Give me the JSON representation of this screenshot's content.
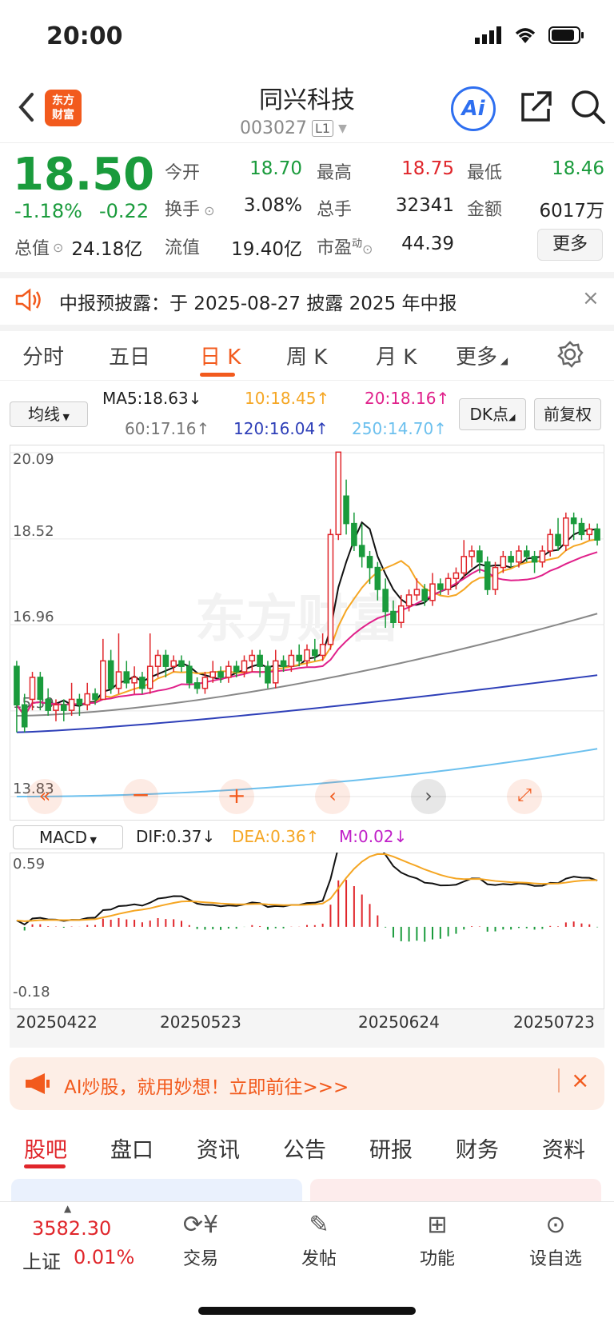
{
  "status": {
    "time": "20:00"
  },
  "header": {
    "logo_line1": "东方",
    "logo_line2": "财富",
    "name": "同兴科技",
    "code": "003027",
    "level": "L1",
    "ai_label": "Ai"
  },
  "quote": {
    "price": "18.50",
    "change_pct": "-1.18%",
    "change": "-0.22",
    "open_label": "今开",
    "open": "18.70",
    "high_label": "最高",
    "high": "18.75",
    "low_label": "最低",
    "low": "18.46",
    "turnover_label": "换手",
    "turnover": "3.08%",
    "volume_label": "总手",
    "volume": "32341",
    "amount_label": "金额",
    "amount": "6017万",
    "mktcap_label": "总值",
    "mktcap": "24.18亿",
    "float_label": "流值",
    "float": "19.40亿",
    "pe_label": "市盈",
    "pe_sup": "动",
    "pe": "44.39",
    "more_label": "更多"
  },
  "notice": {
    "text": "中报预披露：于 2025-08-27 披露 2025 年中报"
  },
  "chart_tabs": [
    "分时",
    "五日",
    "日 K",
    "周 K",
    "月 K",
    "更多"
  ],
  "active_tab": "日 K",
  "ma_bar": {
    "selector": "均线",
    "ma5": "MA5:18.63",
    "ma10": "10:18.45",
    "ma20": "20:18.16",
    "ma60": "60:17.16",
    "ma120": "120:16.04",
    "ma250": "250:14.70",
    "dk_label": "DK点",
    "fq_label": "前复权"
  },
  "price_axis": [
    "20.09",
    "18.52",
    "16.96",
    "15.39",
    "13.83"
  ],
  "macd_bar": {
    "selector": "MACD",
    "dif": "DIF:0.37",
    "dea": "DEA:0.36",
    "m": "M:0.02"
  },
  "macd_axis": [
    "0.59",
    "-0.18"
  ],
  "dates": [
    "20250422",
    "20250523",
    "20250624",
    "20250723"
  ],
  "watermark": "东方财富",
  "colors": {
    "up": "#e0262b",
    "down": "#1a9b3c",
    "ma5": "#111111",
    "ma10": "#f5a623",
    "ma20": "#e0208a",
    "ma60": "#888888",
    "ma120": "#2e3fb8",
    "ma250": "#6cc0ee",
    "accent": "#f25a1d"
  },
  "chart_data": {
    "type": "candlestick",
    "y_range": [
      13.83,
      20.09
    ],
    "candles": [
      [
        16.2,
        15.5,
        16.3,
        15.0
      ],
      [
        15.5,
        15.1,
        15.7,
        15.0
      ],
      [
        15.6,
        16.0,
        16.1,
        15.4
      ],
      [
        16.0,
        15.6,
        16.1,
        15.4
      ],
      [
        15.6,
        15.4,
        15.8,
        15.3
      ],
      [
        15.4,
        15.5,
        15.6,
        15.2
      ],
      [
        15.5,
        15.4,
        15.6,
        15.2
      ],
      [
        15.4,
        15.6,
        15.9,
        15.3
      ],
      [
        15.6,
        15.5,
        15.7,
        15.3
      ],
      [
        15.5,
        15.7,
        15.9,
        15.4
      ],
      [
        15.7,
        15.6,
        15.8,
        15.5
      ],
      [
        15.6,
        16.3,
        16.7,
        15.6
      ],
      [
        16.3,
        15.8,
        16.5,
        15.7
      ],
      [
        15.8,
        16.1,
        16.8,
        15.7
      ],
      [
        16.1,
        15.9,
        16.3,
        15.8
      ],
      [
        15.9,
        16.0,
        16.2,
        15.7
      ],
      [
        16.0,
        15.8,
        16.1,
        15.7
      ],
      [
        15.8,
        16.2,
        16.8,
        15.7
      ],
      [
        16.2,
        16.4,
        16.5,
        16.0
      ],
      [
        16.4,
        16.2,
        16.5,
        16.0
      ],
      [
        16.2,
        16.3,
        16.4,
        16.1
      ],
      [
        16.3,
        16.2,
        16.4,
        16.1
      ],
      [
        16.2,
        15.9,
        16.3,
        15.8
      ],
      [
        15.9,
        15.8,
        16.0,
        15.7
      ],
      [
        15.8,
        16.0,
        16.1,
        15.7
      ],
      [
        16.0,
        16.1,
        16.3,
        15.9
      ],
      [
        16.1,
        16.0,
        16.2,
        15.9
      ],
      [
        16.0,
        16.2,
        16.3,
        15.9
      ],
      [
        16.2,
        16.1,
        16.3,
        16.0
      ],
      [
        16.1,
        16.3,
        16.4,
        16.0
      ],
      [
        16.3,
        16.4,
        16.5,
        16.1
      ],
      [
        16.4,
        16.2,
        16.5,
        16.0
      ],
      [
        16.2,
        15.9,
        16.3,
        15.8
      ],
      [
        15.9,
        16.3,
        16.5,
        15.8
      ],
      [
        16.3,
        16.2,
        16.4,
        16.1
      ],
      [
        16.2,
        16.4,
        16.5,
        16.1
      ],
      [
        16.4,
        16.3,
        16.6,
        16.2
      ],
      [
        16.3,
        16.5,
        16.6,
        16.2
      ],
      [
        16.5,
        16.4,
        16.7,
        16.3
      ],
      [
        16.4,
        16.6,
        16.8,
        16.3
      ],
      [
        16.6,
        18.6,
        18.7,
        16.5
      ],
      [
        18.6,
        20.1,
        20.09,
        18.5
      ],
      [
        19.3,
        18.8,
        19.6,
        18.6
      ],
      [
        18.8,
        18.4,
        19.0,
        18.3
      ],
      [
        18.4,
        18.2,
        18.8,
        18.0
      ],
      [
        18.2,
        18.0,
        18.3,
        17.7
      ],
      [
        18.0,
        17.6,
        18.1,
        17.4
      ],
      [
        17.6,
        17.2,
        17.8,
        16.9
      ],
      [
        17.2,
        17.0,
        17.4,
        16.9
      ],
      [
        17.0,
        17.3,
        17.5,
        16.9
      ],
      [
        17.3,
        17.5,
        17.6,
        17.2
      ],
      [
        17.5,
        17.6,
        17.8,
        17.4
      ],
      [
        17.6,
        17.4,
        17.7,
        17.3
      ],
      [
        17.4,
        17.7,
        17.9,
        17.3
      ],
      [
        17.7,
        17.6,
        17.8,
        17.5
      ],
      [
        17.6,
        17.8,
        17.9,
        17.5
      ],
      [
        17.8,
        17.9,
        18.0,
        17.6
      ],
      [
        17.9,
        18.2,
        18.5,
        17.8
      ],
      [
        18.2,
        18.3,
        18.4,
        18.0
      ],
      [
        18.3,
        18.1,
        18.4,
        17.9
      ],
      [
        18.1,
        17.6,
        18.2,
        17.5
      ],
      [
        17.6,
        18.0,
        18.1,
        17.5
      ],
      [
        18.0,
        18.2,
        18.3,
        17.9
      ],
      [
        18.2,
        18.1,
        18.3,
        18.0
      ],
      [
        18.1,
        18.3,
        18.4,
        18.0
      ],
      [
        18.3,
        18.2,
        18.4,
        18.1
      ],
      [
        18.2,
        18.1,
        18.3,
        17.9
      ],
      [
        18.1,
        18.3,
        18.4,
        18.0
      ],
      [
        18.3,
        18.6,
        18.7,
        18.2
      ],
      [
        18.6,
        18.4,
        18.9,
        18.3
      ],
      [
        18.4,
        18.9,
        19.0,
        18.3
      ],
      [
        18.9,
        18.8,
        19.0,
        18.5
      ],
      [
        18.8,
        18.6,
        18.9,
        18.5
      ],
      [
        18.6,
        18.7,
        18.8,
        18.5
      ],
      [
        18.7,
        18.5,
        18.8,
        18.4
      ]
    ]
  },
  "promo": {
    "text": "AI炒股，就用妙想！立即前往>>>"
  },
  "section_tabs": [
    "股吧",
    "盘口",
    "资讯",
    "公告",
    "研报",
    "财务",
    "资料"
  ],
  "bottom": {
    "index_value": "3582.30",
    "index_name": "上证",
    "index_pct": "0.01%",
    "trade": "交易",
    "post": "发帖",
    "func": "功能",
    "watch": "设自选"
  }
}
